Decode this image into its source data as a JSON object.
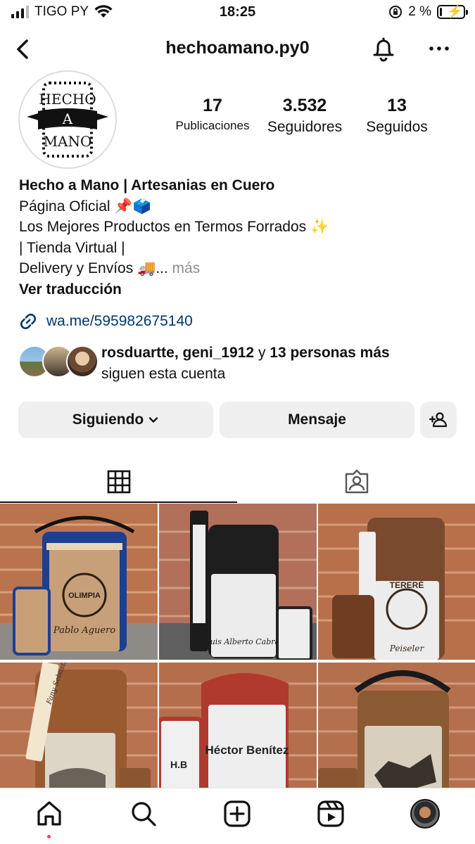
{
  "status_bar": {
    "carrier": "TIGO PY",
    "time": "18:25",
    "battery": "2 %"
  },
  "header": {
    "username": "hechoamano.py0"
  },
  "avatar": {
    "logo_lines": [
      "HECHO",
      "A",
      "MANO"
    ]
  },
  "stats": [
    {
      "value": "17",
      "label": "Publicaciones"
    },
    {
      "value": "3.532",
      "label": "Seguidores"
    },
    {
      "value": "13",
      "label": "Seguidos"
    }
  ],
  "bio": {
    "name": "Hecho a Mano | Artesanias en Cuero",
    "line1": "Página Oficial 📌🗳️",
    "line2": "Los Mejores Productos en Termos Forrados ✨",
    "line3": "| Tienda Virtual |",
    "line4": "Delivery y Envíos 🚚...",
    "more": "más",
    "translate": "Ver traducción",
    "link": "wa.me/595982675140"
  },
  "followed_by": {
    "names": "rosduartte, geni_1912",
    "connector": "y",
    "others": "13 personas más",
    "suffix": "siguen esta cuenta"
  },
  "actions": {
    "following": "Siguiendo",
    "message": "Mensaje"
  },
  "tabs": [
    "grid-icon",
    "tagged-icon"
  ],
  "posts": [
    {
      "text1": "OLIMPIA",
      "text2": "Pablo Aguero",
      "accent": "#1d3f8f"
    },
    {
      "text1": "Luis Alberto Cabral",
      "text2": "Luis Alberto Cabral",
      "accent": "#222222"
    },
    {
      "text1": "Peiseler",
      "text2": "TERERÉ",
      "accent": "#7a4a2e"
    },
    {
      "text1": "Fany Sebastián",
      "text2": "",
      "accent": "#9a5a30"
    },
    {
      "text1": "Héctor Benítez",
      "text2": "H.B",
      "accent": "#b03a2e"
    },
    {
      "text1": "",
      "text2": "",
      "accent": "#8a5a32"
    }
  ],
  "bottom_nav": [
    "home-icon",
    "search-icon",
    "create-icon",
    "reels-icon",
    "profile-avatar"
  ],
  "colors": {
    "link": "#00376b",
    "button_bg": "#efefef",
    "muted": "#8e8e8e",
    "notification_dot": "#ed4956"
  }
}
